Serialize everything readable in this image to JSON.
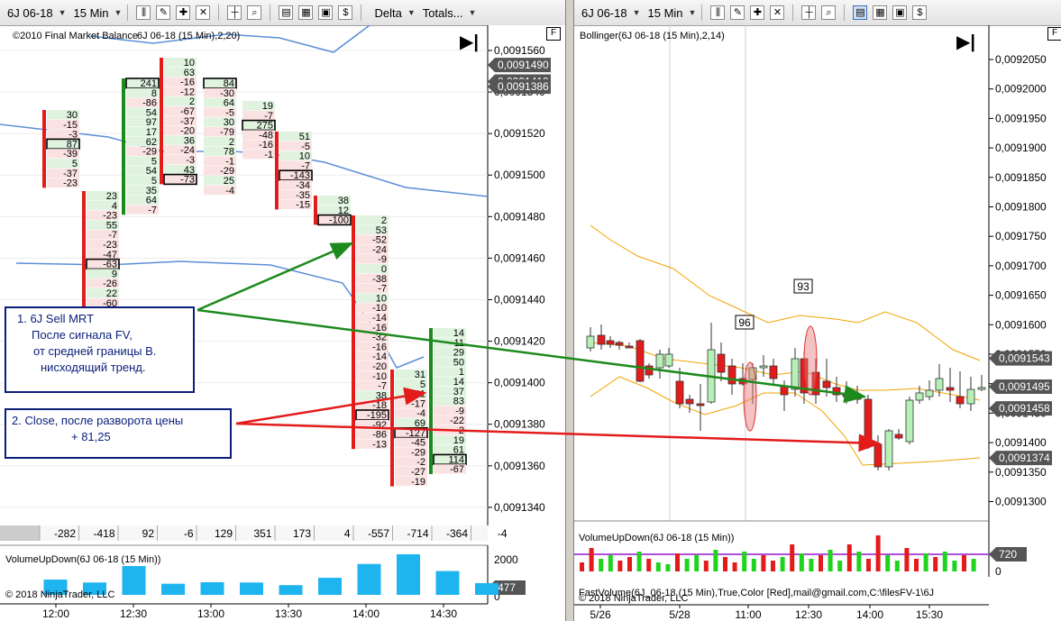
{
  "left": {
    "toolbar": {
      "instrument": "6J 06-18",
      "interval": "15 Min",
      "style_label": "Delta",
      "style2_label": "Totals..."
    },
    "header_text": "©2010 Final Market Balance",
    "indicator_label": "6J 06-18 (15 Min),2,20)",
    "f_label": "F",
    "price_axis": [
      "0,0091560",
      "0,0091540",
      "0,0091520",
      "0,0091500",
      "0,0091480",
      "0,0091460",
      "0,0091440",
      "0,0091420",
      "0,0091400",
      "0,0091380",
      "0,0091360",
      "0,0091340"
    ],
    "price_markers": [
      {
        "label": "0,0091490",
        "price": 0.009149
      },
      {
        "label": "0,0091410",
        "price": 0.009141
      },
      {
        "label": "0,0091386",
        "price": 0.0091386
      }
    ],
    "time_axis": [
      "12:00",
      "12:30",
      "13:00",
      "13:30",
      "14:00",
      "14:30"
    ],
    "totals": [
      "-282",
      "-418",
      "92",
      "-6",
      "129",
      "351",
      "173",
      "4",
      "-557",
      "-714",
      "-364",
      "-4"
    ],
    "footprint_columns": [
      {
        "cells": [
          "30",
          "-15",
          "-3",
          "87",
          "-39",
          "5",
          "-37",
          "-23"
        ],
        "box": 3
      },
      {
        "cells": [
          "23",
          "4",
          "-23",
          "55",
          "-7",
          "-23",
          "-47",
          "-63",
          "9",
          "-26",
          "22",
          "-60"
        ],
        "box": 7
      },
      {
        "cells": [
          "241",
          "8",
          "-86",
          "54",
          "97",
          "17",
          "62",
          "-29",
          "5",
          "54",
          "5",
          "35",
          "64",
          "-7"
        ],
        "box": 0
      },
      {
        "cells": [
          "10",
          "63",
          "-16",
          "-12",
          "2",
          "-67",
          "-37",
          "-20",
          "36",
          "-24",
          "-3",
          "43",
          "-73"
        ],
        "box": 12
      },
      {
        "cells": [
          "84",
          "-30",
          "64",
          "-5",
          "30",
          "-79",
          "2",
          "78",
          "-1",
          "-29",
          "25",
          "-4"
        ],
        "box": 0
      },
      {
        "cells": [
          "19",
          "-7",
          "275",
          "-48",
          "-16",
          "-1"
        ],
        "box": 2
      },
      {
        "cells": [
          "51",
          "-5",
          "10",
          "-7",
          "-143",
          "-34",
          "-35",
          "-15"
        ],
        "box": 4
      },
      {
        "cells": [
          "38",
          "12",
          "-100"
        ],
        "box": 2
      },
      {
        "cells": [
          "2",
          "53",
          "-52",
          "-24",
          "-9",
          "0",
          "-38",
          "-7",
          "10",
          "-10",
          "-14",
          "-16",
          "-32",
          "-16",
          "-14",
          "-20",
          "-10",
          "-7",
          "38",
          "-18",
          "-195",
          "-92",
          "-86",
          "-13"
        ],
        "box": 20
      },
      {
        "cells": [
          "31",
          "5",
          "11",
          "-17",
          "-4",
          "69",
          "-127",
          "-45",
          "-29",
          "-2",
          "-27",
          "-19"
        ],
        "box": 6
      },
      {
        "cells": [
          "14",
          "11",
          "29",
          "50",
          "1",
          "14",
          "37",
          "83",
          "-9",
          "-22",
          "-2",
          "19",
          "61",
          "114",
          "-67"
        ],
        "box": 13
      }
    ],
    "volume_panel_label": "VolumeUpDown(6J 06-18 (15 Min))",
    "volume_axis": [
      "2000",
      "0"
    ],
    "volume_marker": "477",
    "volume_bars": [
      0,
      520,
      420,
      980,
      380,
      430,
      420,
      330,
      580,
      1050,
      1380,
      810,
      400
    ],
    "copyright": "© 2018 NinjaTrader, LLC"
  },
  "right": {
    "toolbar": {
      "instrument": "6J 06-18",
      "interval": "15 Min"
    },
    "indicator_label": "Bollinger(6J 06-18 (15 Min),2,14)",
    "f_label": "F",
    "price_axis": [
      "0,0092050",
      "0,0092000",
      "0,0091950",
      "0,0091900",
      "0,0091850",
      "0,0091800",
      "0,0091750",
      "0,0091700",
      "0,0091650",
      "0,0091600",
      "0,0091550",
      "0,0091500",
      "0,0091450",
      "0,0091400",
      "0,0091350",
      "0,0091300"
    ],
    "price_markers": [
      {
        "label": "0,0091543",
        "price": 0.0091543
      },
      {
        "label": "0,0091495",
        "price": 0.0091495
      },
      {
        "label": "0,0091458",
        "price": 0.0091458
      },
      {
        "label": "0,0091374",
        "price": 0.0091374
      }
    ],
    "bar_labels": [
      "96",
      "93"
    ],
    "time_axis": [
      "5/26",
      "5/28",
      "11:00",
      "12:30",
      "14:00",
      "15:30"
    ],
    "volume_panel_label": "VolumeUpDown(6J 06-18 (15 Min))",
    "volume_axis": [
      "720",
      "0"
    ],
    "volume_marker": "720",
    "fast_volume_label": "FastVolume(6J_06-18 (15 Min),True,Color [Red],mail@gmail.com,C:\\filesFV-1\\6J",
    "copyright": "© 2018 NinjaTrader, LLC"
  },
  "annotations": {
    "note1": [
      "1.  6J  Sell MRT",
      "После сигнала FV,",
      "от средней границы В.",
      "нисходящий тренд."
    ],
    "note2": [
      "2. Close, после разворота цены",
      "+ 81,25"
    ]
  },
  "colors": {
    "up": "#2e8b2e",
    "down": "#e31b1b",
    "arrow_green": "#1d8a1d",
    "arrow_red": "#e31b1b",
    "ma_blue": "#5b8fd8",
    "bollinger": "#f2a300"
  }
}
